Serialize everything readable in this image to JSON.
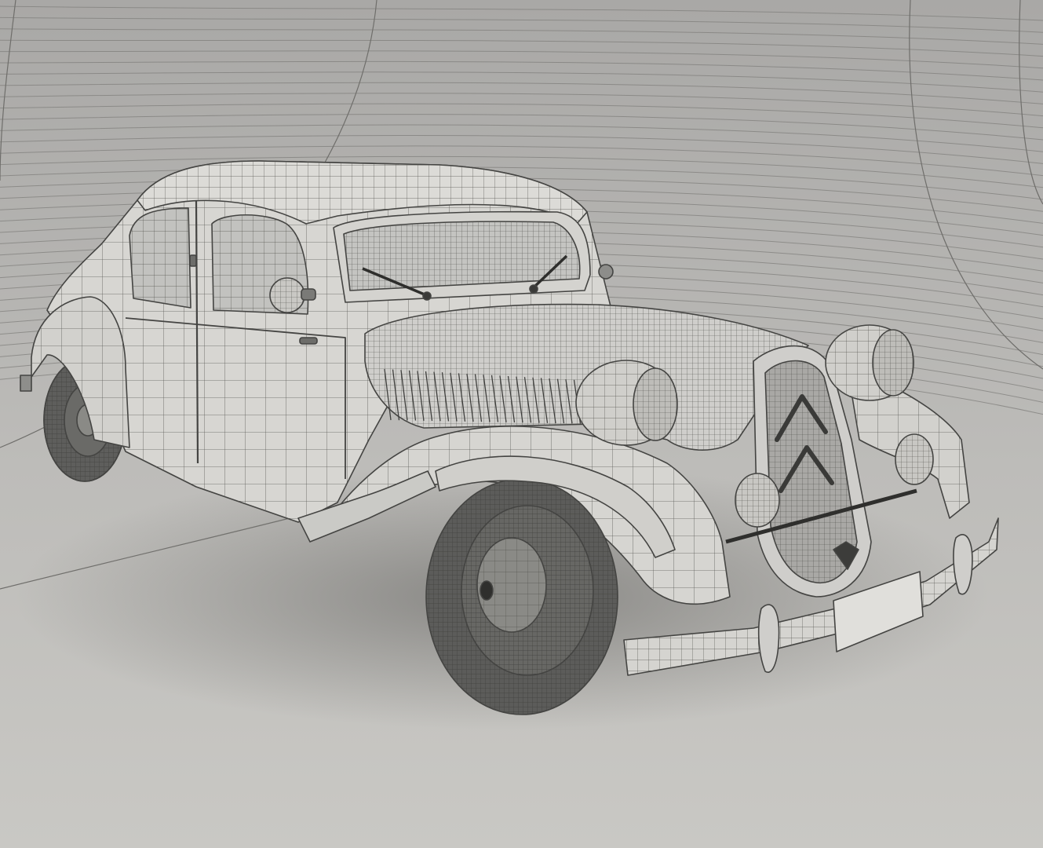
{
  "scene": {
    "subject": "vintage-sedan-wireframe-render",
    "colors": {
      "backdrop_top": "#a9a8a6",
      "backdrop_bottom": "#c8c7c4",
      "floor": "#c7c6c2",
      "wire": "#4a4a48",
      "body_fill": "#d9d8d4",
      "tire": "#5e5e5c",
      "glass": "#c2c2bf",
      "shadow": "#8e8d8a"
    }
  }
}
